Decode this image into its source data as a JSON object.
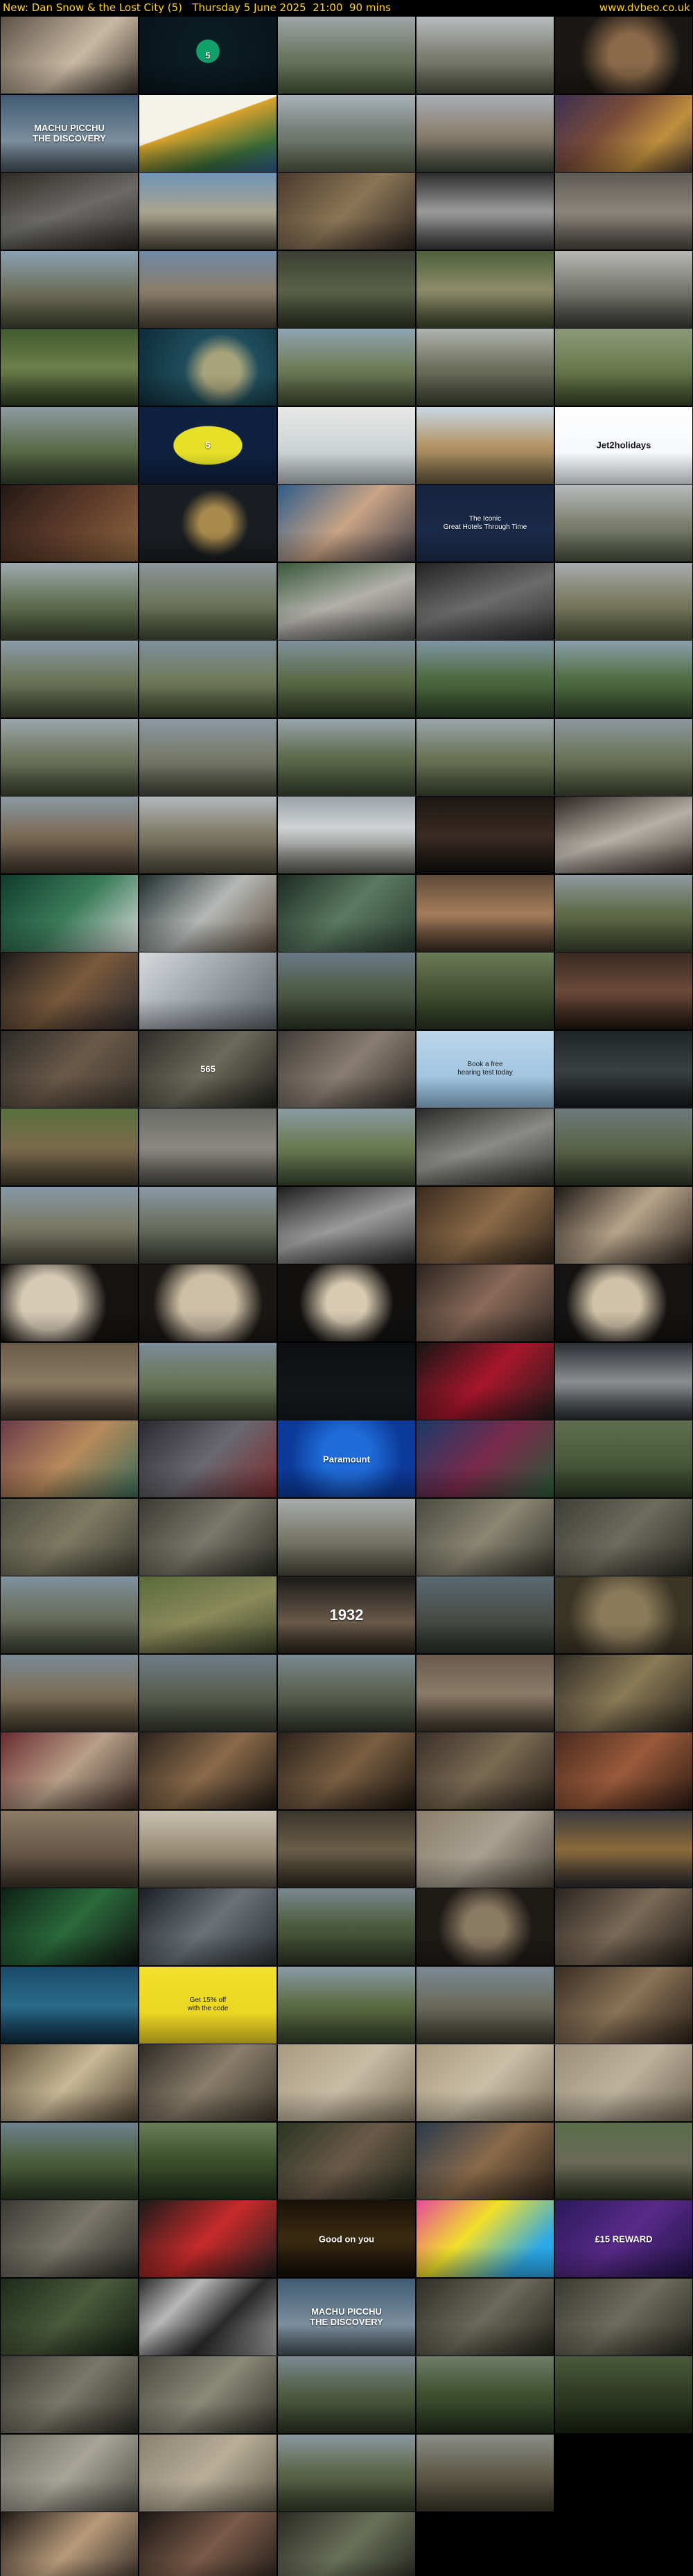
{
  "header": {
    "title": "New: Dan Snow & the Lost City (5)   Thursday 5 June 2025  21:00  90 mins",
    "site": "www.dvbeo.co.uk"
  },
  "frames": [
    {
      "bg": "linear-gradient(135deg,#5b5247,#c9b9a2 55%,#3a342d)"
    },
    {
      "bg": "radial-gradient(circle at 50% 45%,#12a06a 0 14%,#0b1d23 15%,#07141a 100%)",
      "caption": "5"
    },
    {
      "bg": "linear-gradient(180deg,#9fa6a9,#6c7762 50%,#4b5a3c)"
    },
    {
      "bg": "linear-gradient(180deg,#b8bcbf,#7d7f73 50%,#505444)"
    },
    {
      "bg": "radial-gradient(circle at 55% 50%,#8b6a4a 0 25%,#1b1714 60%)"
    },
    {
      "bg": "linear-gradient(180deg,#3f5b73,#7c8f9e 60%,#45525a)",
      "caption": "MACHU PICCHU\nTHE DISCOVERY"
    },
    {
      "bg": "linear-gradient(160deg,#f3f3ea 0 40%,#d8a22b 41%,#3a6b37 75%,#2d5b8f)"
    },
    {
      "bg": "linear-gradient(180deg,#a9b2b8,#777f79 45%,#515a44)"
    },
    {
      "bg": "linear-gradient(180deg,#a7aeb5,#8b7f6f 50%,#3e4539)"
    },
    {
      "bg": "linear-gradient(135deg,#3b2f52,#7a4c39 40%,#bf8f3e 70%,#4b3a2d)"
    },
    {
      "bg": "linear-gradient(160deg,#2f2b26,#6b6a66 50%,#2a2722)"
    },
    {
      "bg": "linear-gradient(180deg,#6f93b8,#a9a48f 50%,#4f4a3c)"
    },
    {
      "bg": "linear-gradient(135deg,#4a3a2c,#8b7556 50%,#2d2520)"
    },
    {
      "bg": "linear-gradient(180deg,#2c2c2c,#9a9a9a 50%,#3b3b3b)"
    },
    {
      "bg": "linear-gradient(180deg,#5e5a54,#8b847a 50%,#4c4842)"
    },
    {
      "bg": "linear-gradient(180deg,#8aa1b3,#6b6c57 55%,#42462f)"
    },
    {
      "bg": "linear-gradient(180deg,#6f8aa6,#8a7d6b 50%,#4a4336)"
    },
    {
      "bg": "linear-gradient(180deg,#3a3d31,#5a6147 50%,#2e3324)"
    },
    {
      "bg": "linear-gradient(180deg,#4d5f3a,#8c8b6a 50%,#3d452b)"
    },
    {
      "bg": "linear-gradient(180deg,#b8b8b4,#6a6a64 60%,#3a3a35)"
    },
    {
      "bg": "linear-gradient(180deg,#3f5a2f,#6d7f4a 50%,#2f3e22)"
    },
    {
      "bg": "radial-gradient(circle at 60% 55%,#a7a37a 0 20%,#1f4d5c 40%,#0e2b38 100%)"
    },
    {
      "bg": "linear-gradient(180deg,#8fa5b3,#6f7d5a 50%,#434c30)"
    },
    {
      "bg": "linear-gradient(180deg,#b0b4b0,#6e6f5d 50%,#3d4332)"
    },
    {
      "bg": "linear-gradient(180deg,#8d9a7a,#6c7a4f 50%,#3b4729)"
    },
    {
      "bg": "linear-gradient(180deg,#8e9ba3,#5a6b48 55%,#34402a)"
    },
    {
      "bg": "radial-gradient(ellipse at 50% 50%,#e6e028 0 35%,#0e2140 36%)",
      "caption": "5"
    },
    {
      "bg": "linear-gradient(180deg,#e8e8e6,#cfd5d6 50%,#b5bdc0)"
    },
    {
      "bg": "linear-gradient(180deg,#c9d8e6,#b49565 50%,#6a5a3e)"
    },
    {
      "bg": "linear-gradient(180deg,#ffffff,#eef2f7)",
      "caption": "Jet2holidays",
      "dark": true
    },
    {
      "bg": "linear-gradient(135deg,#231815,#5d3b2a 50%,#8e6640)"
    },
    {
      "bg": "radial-gradient(circle at 55% 50%,#a78a4c 0 18%,#1a1d22 40%)"
    },
    {
      "bg": "linear-gradient(135deg,#2e5b8a,#c9a486 50%,#3b3b45)"
    },
    {
      "bg": "linear-gradient(180deg,#15233d,#1c2e4f)",
      "caption": "The Iconic\nGreat Hotels Through Time",
      "small": true
    },
    {
      "bg": "linear-gradient(180deg,#b9bcbf,#7d806e 50%,#4b5241)"
    },
    {
      "bg": "linear-gradient(180deg,#9ea9b0,#5e6b4c 55%,#3b4530)"
    },
    {
      "bg": "linear-gradient(180deg,#8c959c,#6e765c 50%,#414a33)"
    },
    {
      "bg": "linear-gradient(160deg,#39593b,#b2b0aa 50%,#4c4c4a)"
    },
    {
      "bg": "linear-gradient(160deg,#232323,#6b6b6b 50%,#2d2d2d)"
    },
    {
      "bg": "linear-gradient(180deg,#a7abad,#7a7a60 50%,#4f5638)"
    },
    {
      "bg": "linear-gradient(180deg,#8a9cab,#6c7458 50%,#3f4732)"
    },
    {
      "bg": "linear-gradient(180deg,#7d909d,#707a5b 50%,#404a2e)"
    },
    {
      "bg": "linear-gradient(180deg,#7f929f,#5a6b46 50%,#344029)"
    },
    {
      "bg": "linear-gradient(180deg,#7f96a4,#4c6a3f 50%,#2e4327)"
    },
    {
      "bg": "linear-gradient(180deg,#8aa0ad,#4f6d42 50%,#314629)"
    },
    {
      "bg": "linear-gradient(180deg,#9aa6ad,#6e745c 50%,#3d4432)"
    },
    {
      "bg": "linear-gradient(180deg,#8d9aa3,#77796a 50%,#45493c)"
    },
    {
      "bg": "linear-gradient(180deg,#98a5ad,#5d6a4b 50%,#384330)"
    },
    {
      "bg": "linear-gradient(180deg,#9ba6ac,#6b7356 50%,#3f4632)"
    },
    {
      "bg": "linear-gradient(180deg,#8d98a1,#6b7458 50%,#3f4632)"
    },
    {
      "bg": "linear-gradient(180deg,#8a9aa5,#7a6a55 50%,#3d352b)"
    },
    {
      "bg": "linear-gradient(180deg,#b3b8bc,#7c7864 50%,#4b4738)"
    },
    {
      "bg": "linear-gradient(180deg,#9aa3aa,#cfd2d3 40%,#5c5c55)"
    },
    {
      "bg": "linear-gradient(180deg,#1a1613,#3a2b22 50%,#120f0d)"
    },
    {
      "bg": "linear-gradient(160deg,#2c2520,#b7b0a8 50%,#3b332c)"
    },
    {
      "bg": "linear-gradient(135deg,#0f3b2d,#3a7c5a 50%,#dedede)"
    },
    {
      "bg": "linear-gradient(135deg,#1f2d2d,#b5b8b6 50%,#5a4a3a)"
    },
    {
      "bg": "linear-gradient(135deg,#1d2a22,#5a7a62 50%,#2a3b30)"
    },
    {
      "bg": "linear-gradient(180deg,#5e4a3a,#a47c5a 50%,#3a2c22)"
    },
    {
      "bg": "linear-gradient(180deg,#909aa1,#5f6a47 50%,#3b442c)"
    },
    {
      "bg": "linear-gradient(135deg,#1b1a1c,#7a5a3c 50%,#2c2a2e)"
    },
    {
      "bg": "linear-gradient(135deg,#d6dadd,#9aa0a6 50%,#5a6066)"
    },
    {
      "bg": "linear-gradient(180deg,#6a7a86,#4d5a45 50%,#2d3526)"
    },
    {
      "bg": "linear-gradient(180deg,#6b7a57,#3d4a2c 60%,#2a3320)"
    },
    {
      "bg": "linear-gradient(180deg,#3a2a22,#6a4a38 50%,#22160f)"
    },
    {
      "bg": "linear-gradient(135deg,#2b2a28,#6a5a48 50%,#3a342c)"
    },
    {
      "bg": "linear-gradient(135deg,#2e2c2a,#6b6a5a 50%,#1f1e1c)",
      "caption": "565"
    },
    {
      "bg": "linear-gradient(135deg,#3e3a36,#8a7e72 50%,#2e2a26)"
    },
    {
      "bg": "linear-gradient(180deg,#bcd6ea,#8fb8d8)",
      "caption": "Book a free\nhearing test today",
      "dark": true,
      "small": true
    },
    {
      "bg": "linear-gradient(180deg,#1f2427,#3a4042 50%,#15191b)"
    },
    {
      "bg": "linear-gradient(180deg,#58703c,#7a6a4c 50%,#40382a)"
    },
    {
      "bg": "linear-gradient(180deg,#6a6a66,#8a8880 50%,#4a4944)"
    },
    {
      "bg": "linear-gradient(180deg,#8a9ca4,#6a7a50 50%,#3a4830)"
    },
    {
      "bg": "linear-gradient(160deg,#2a2a2a,#8a8a86 50%,#2e2e2c)"
    },
    {
      "bg": "linear-gradient(180deg,#6e7a7e,#5a6448 50%,#2e3426)"
    },
    {
      "bg": "linear-gradient(180deg,#8598a6,#7a7a66 50%,#4a4a3c)"
    },
    {
      "bg": "linear-gradient(180deg,#8a9aa6,#6a6e60 50%,#3a3e34)"
    },
    {
      "bg": "linear-gradient(160deg,#1e1e1e,#9a9a9a 50%,#2a2a2a)"
    },
    {
      "bg": "linear-gradient(135deg,#3a2a1e,#8a6a48 50%,#2e2218)"
    },
    {
      "bg": "linear-gradient(135deg,#1e1a16,#b8a48a 50%,#2a241e)"
    },
    {
      "bg": "radial-gradient(circle at 35% 50%,#d6cab4 0 28%,#151311 60%)"
    },
    {
      "bg": "radial-gradient(circle at 50% 50%,#cdbfa6 0 35%,#1a1714 70%)"
    },
    {
      "bg": "radial-gradient(circle at 50% 50%,#d8cbb2 0 25%,#121110 60%)"
    },
    {
      "bg": "linear-gradient(135deg,#2a2420,#8a6a58 50%,#2e2622)"
    },
    {
      "bg": "radial-gradient(circle at 45% 50%,#d0c2a8 0 28%,#151311 60%)"
    },
    {
      "bg": "linear-gradient(180deg,#6a5a48,#8a7a62 50%,#3e342a)"
    },
    {
      "bg": "linear-gradient(180deg,#7a8c98,#6a7658 50%,#3c4630)"
    },
    {
      "bg": "linear-gradient(180deg,#0d0f12,#161a1e)"
    },
    {
      "bg": "linear-gradient(135deg,#151515,#a8162a 50%,#1c1c1c)"
    },
    {
      "bg": "linear-gradient(180deg,#2a2e33,#8a8e90 50%,#2a2e33)"
    },
    {
      "bg": "linear-gradient(135deg,#6a3a4a,#b88a5a 50%,#3a6a5a)"
    },
    {
      "bg": "linear-gradient(135deg,#2c2a30,#6a6870 50%,#7a2a2e)"
    },
    {
      "bg": "radial-gradient(circle at 50% 45%,#1f6bd8 0 30%,#0c3a9a 70%)",
      "caption": "Paramount"
    },
    {
      "bg": "linear-gradient(135deg,#1a3a6a,#7a2a4a 50%,#2a5a3a)"
    },
    {
      "bg": "linear-gradient(180deg,#5e6e4e,#4a5a3a 50%,#2e3a24)"
    },
    {
      "bg": "linear-gradient(135deg,#4a4a3e,#7e7a62 50%,#3a3a30)"
    },
    {
      "bg": "linear-gradient(135deg,#3a3a34,#7a786a 50%,#2c2c26)"
    },
    {
      "bg": "linear-gradient(180deg,#a8acae,#7a7a6a 50%,#4a4a3e)"
    },
    {
      "bg": "linear-gradient(135deg,#4a4a40,#8a8672 50%,#34342c)"
    },
    {
      "bg": "linear-gradient(135deg,#3e3e36,#6e6c5e 50%,#2a2a24)"
    },
    {
      "bg": "linear-gradient(180deg,#7e92a0,#6a6e5c 50%,#3a3e32)"
    },
    {
      "bg": "linear-gradient(160deg,#5a6a3a,#8a8a5a 50%,#3a4228)"
    },
    {
      "bg": "linear-gradient(180deg,#1a1a1a,#6a5a48 60%,#2a241c)",
      "caption": "1932",
      "big": true
    },
    {
      "bg": "linear-gradient(180deg,#5a6a72,#4a4e4a 50%,#2a2e2a)"
    },
    {
      "bg": "radial-gradient(circle at 50% 50%,#8a7a5a 0 30%,#3a3424 70%)"
    },
    {
      "bg": "linear-gradient(180deg,#7a8a96,#7a6e56 50%,#3e3628)"
    },
    {
      "bg": "linear-gradient(180deg,#6e7e88,#5a5e50 50%,#34382e)"
    },
    {
      "bg": "linear-gradient(180deg,#7a8a92,#5a6050 50%,#32362c)"
    },
    {
      "bg": "linear-gradient(180deg,#6a5a4e,#8a7a66 50%,#3a3228)"
    },
    {
      "bg": "linear-gradient(135deg,#2e2a24,#8a7a56 50%,#2a261e)"
    },
    {
      "bg": "linear-gradient(135deg,#6a2a2e,#b8a088 50%,#3a2a24)"
    },
    {
      "bg": "linear-gradient(135deg,#2a221c,#8a6a4a 50%,#1e1812)"
    },
    {
      "bg": "linear-gradient(135deg,#2a221a,#7a5e42 50%,#1c160f)"
    },
    {
      "bg": "linear-gradient(135deg,#3a3028,#7a6a52 50%,#2a221a)"
    },
    {
      "bg": "linear-gradient(135deg,#4a2a1e,#9a5a3a 50%,#2a1a12)"
    },
    {
      "bg": "linear-gradient(180deg,#8a7a66,#6a5a48 50%,#3a3228)"
    },
    {
      "bg": "linear-gradient(180deg,#c8c0b0,#9a8e78 50%,#5a5244)"
    },
    {
      "bg": "linear-gradient(180deg,#3a342a,#6a5e48 50%,#2e2820)"
    },
    {
      "bg": "linear-gradient(135deg,#8a7e6a,#a8a090 50%,#4a4438)"
    },
    {
      "bg": "linear-gradient(180deg,#3a3a3e,#8a6a3a 50%,#2a2a2e)"
    },
    {
      "bg": "linear-gradient(135deg,#0e2016,#2a6a3a 50%,#111)"
    },
    {
      "bg": "linear-gradient(135deg,#1a1e22,#6a7278 50%,#2a2e32)"
    },
    {
      "bg": "linear-gradient(180deg,#7a8a92,#4a5a3a 50%,#2e3626)"
    },
    {
      "bg": "radial-gradient(circle at 50% 50%,#8a7a62 0 25%,#1e1a16 60%)"
    },
    {
      "bg": "linear-gradient(135deg,#2a2420,#7a6a56 50%,#1e1a16)"
    },
    {
      "bg": "linear-gradient(180deg,#1a4a6a,#2a6a8a 50%,#0e2a3e)"
    },
    {
      "bg": "linear-gradient(180deg,#f2e02a,#e8d020)",
      "caption": "Get 15% off\nwith the code",
      "dark": true,
      "small": true
    },
    {
      "bg": "linear-gradient(180deg,#8a9ca6,#5a6a42 50%,#34402a)"
    },
    {
      "bg": "linear-gradient(180deg,#7a8a96,#6a6a5a 50%,#3a3a30)"
    },
    {
      "bg": "linear-gradient(135deg,#3a2e24,#8a7256 50%,#2a2018)"
    },
    {
      "bg": "linear-gradient(135deg,#5a4a36,#c8b896 50%,#4a3e2e)"
    },
    {
      "bg": "linear-gradient(135deg,#2e2a24,#8a7e6a 50%,#3a342a)"
    },
    {
      "bg": "linear-gradient(135deg,#a89a80,#c8bca4 50%,#7a6e5a)"
    },
    {
      "bg": "linear-gradient(135deg,#a8997e,#cabfa6 50%,#7a6e58)"
    },
    {
      "bg": "linear-gradient(135deg,#9a8e78,#bcb29c 50%,#6e6452)"
    },
    {
      "bg": "linear-gradient(180deg,#6e8290,#4a5e3a 50%,#2a3622)"
    },
    {
      "bg": "linear-gradient(180deg,#6a7e58,#3a4e2a 50%,#22301a)"
    },
    {
      "bg": "linear-gradient(135deg,#2a3422,#6a5a48 50%,#1e2618)"
    },
    {
      "bg": "linear-gradient(135deg,#2a3a4a,#8a6a4a 50%,#2a2218)"
    },
    {
      "bg": "linear-gradient(180deg,#5a6e4a,#6a6a56 50%,#2e3424)"
    },
    {
      "bg": "linear-gradient(135deg,#3a3a34,#7a766a 50%,#2a2a26)"
    },
    {
      "bg": "linear-gradient(135deg,#1a1a1a,#c82a2a 50%,#1e1e1e)"
    },
    {
      "bg": "linear-gradient(180deg,#1a1208,#3a2a10 50%,#120c06)",
      "caption": "Good on you"
    },
    {
      "bg": "linear-gradient(135deg,#e84a9a,#f2e02a 40%,#2aa8e8 80%)"
    },
    {
      "bg": "linear-gradient(135deg,#2a1a5a,#5a2a8a 50%,#1e1244)",
      "caption": "£15 REWARD"
    },
    {
      "bg": "linear-gradient(135deg,#1e2a1a,#4a5a3a 50%,#121a10)"
    },
    {
      "bg": "linear-gradient(135deg,#2a2a2a,#b8b8b8 30%,#2a2a2a 60%,#a8a8a8)"
    },
    {
      "bg": "linear-gradient(180deg,#3f5b73,#7c8f9e 60%,#45525a)",
      "caption": "MACHU PICCHU\nTHE DISCOVERY"
    },
    {
      "bg": "linear-gradient(135deg,#2e2e28,#6a6a5a 50%,#22221c)"
    },
    {
      "bg": "linear-gradient(135deg,#3a3a32,#6e6c5c 50%,#262620)"
    },
    {
      "bg": "linear-gradient(135deg,#3a3a34,#7a7868 50%,#2a2a24)"
    },
    {
      "bg": "linear-gradient(135deg,#4a4a40,#8a8a78 50%,#32322a)"
    },
    {
      "bg": "linear-gradient(180deg,#7a8a92,#4e5a3e 50%,#2c3424)"
    },
    {
      "bg": "linear-gradient(180deg,#6e7e68,#3e4e2e 50%,#22301c)"
    },
    {
      "bg": "linear-gradient(180deg,#4a5a3a,#2e3a22 50%,#1a2212)"
    },
    {
      "bg": "linear-gradient(135deg,#6a6a62,#a8a498 50%,#4a4a42)"
    },
    {
      "bg": "linear-gradient(135deg,#8a8270,#b8ae98 50%,#5e5848)"
    },
    {
      "bg": "linear-gradient(180deg,#8a98a0,#5a6446 50%,#343c2a)"
    },
    {
      "bg": "linear-gradient(180deg,#8a8e88,#5e5a48 50%,#3a3628)"
    },
    {
      "bg": "#000"
    },
    {
      "bg": "linear-gradient(135deg,#1e1a16,#b89a7a 50%,#2a2420)"
    },
    {
      "bg": "linear-gradient(135deg,#1a1614,#7a5a48 50%,#1e1a16)"
    },
    {
      "bg": "linear-gradient(135deg,#2a2a24,#6a7058 50%,#1e201a)"
    }
  ]
}
